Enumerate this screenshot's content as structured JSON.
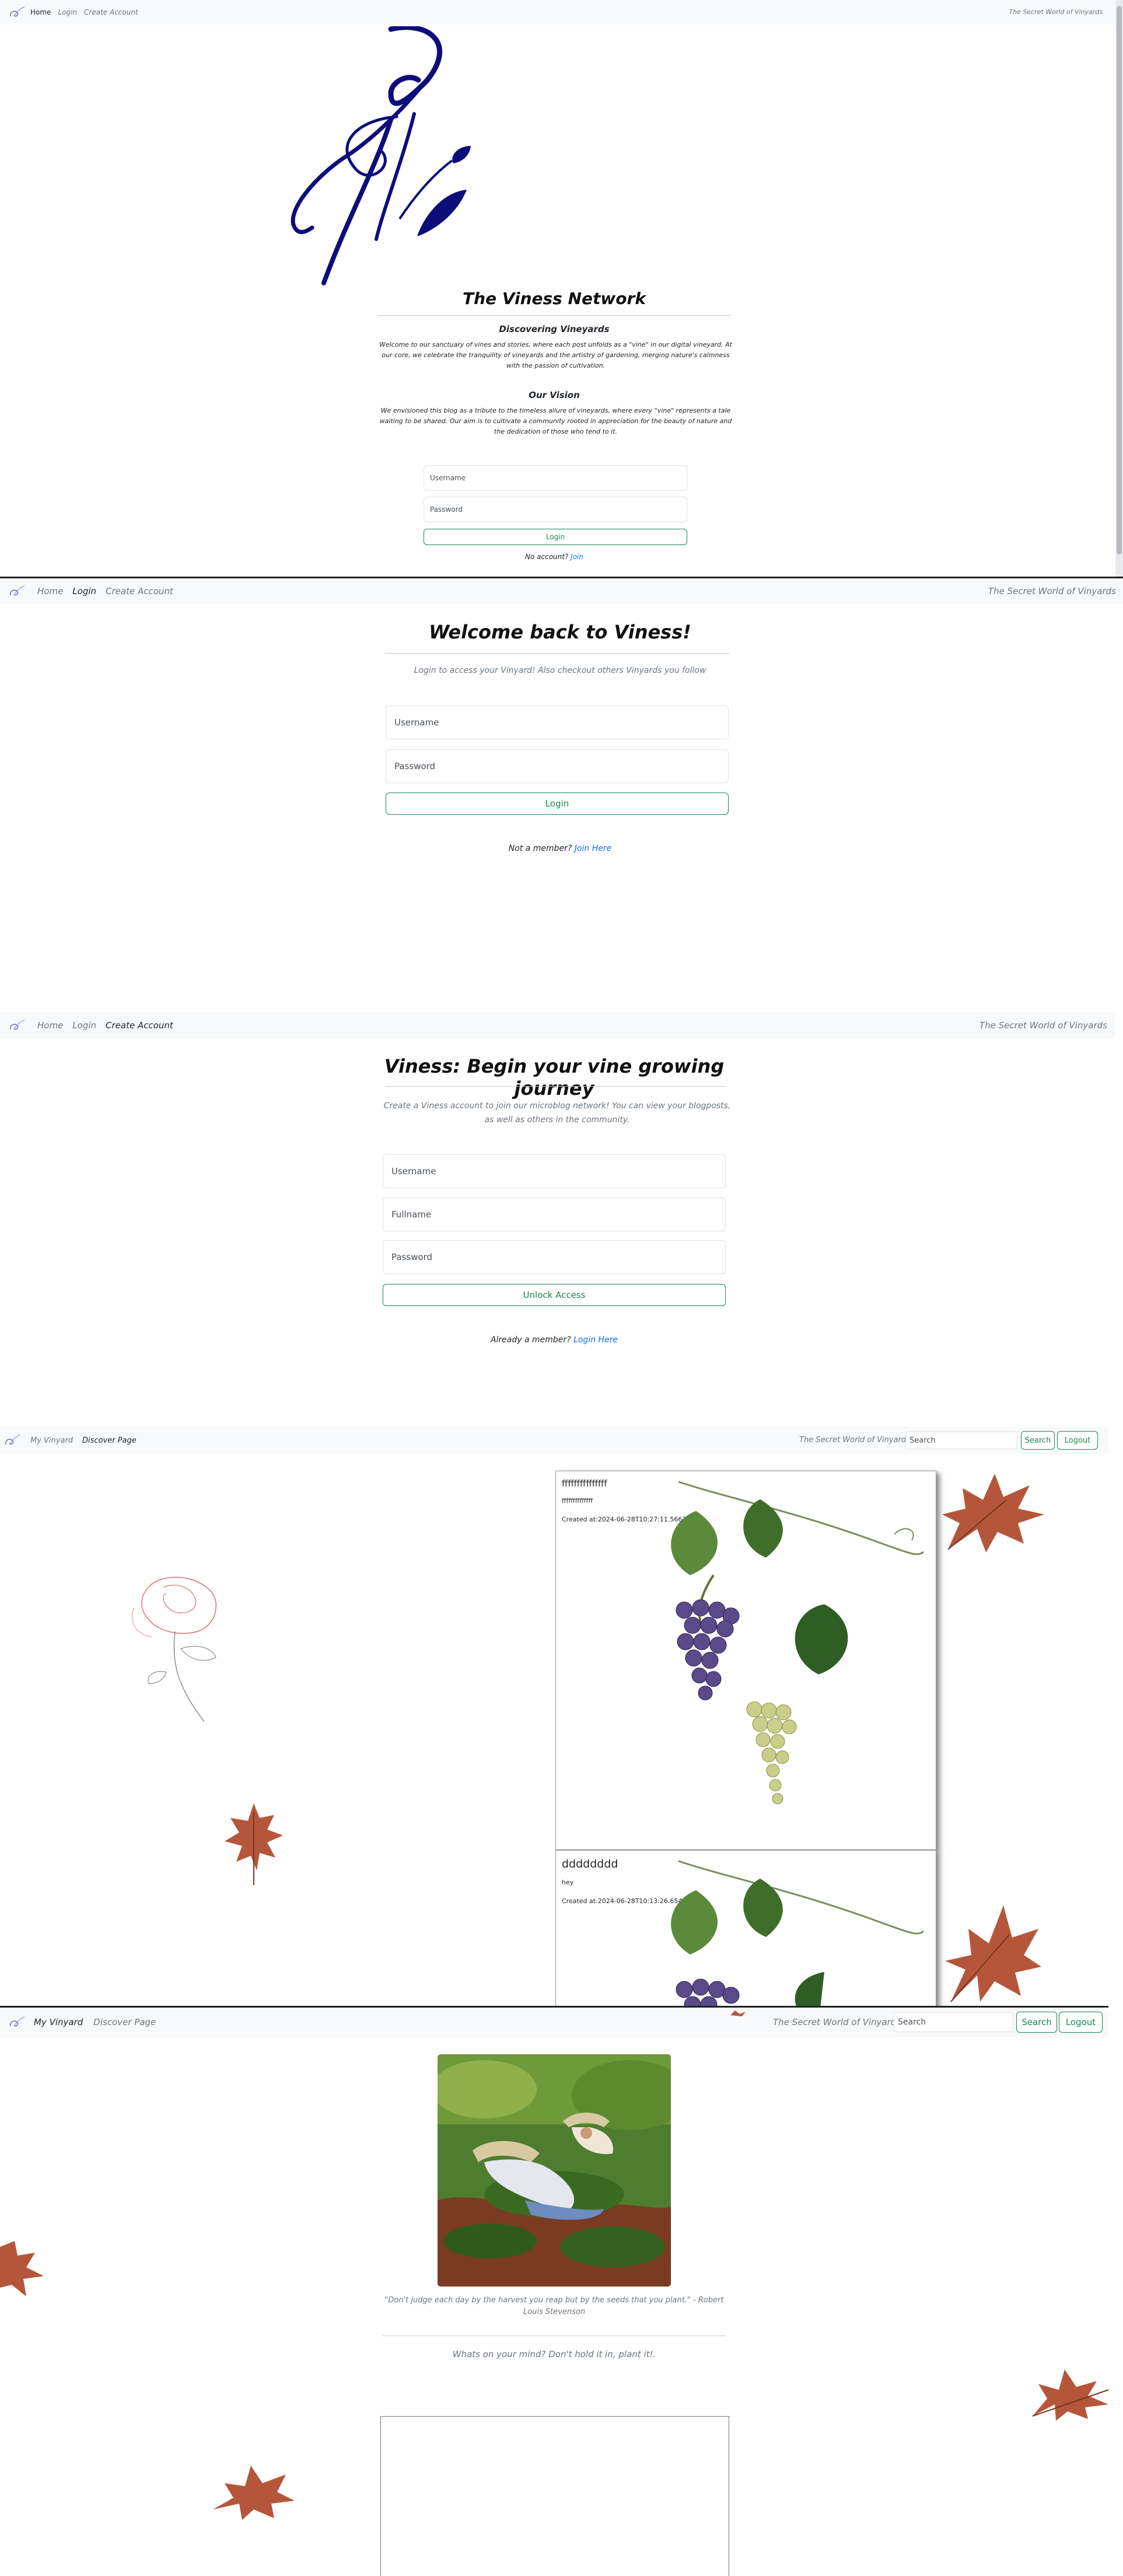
{
  "panel1": {
    "nav": {
      "home": "Home",
      "login": "Login",
      "create": "Create Account",
      "tagline": "The Secret World of Vinyards"
    },
    "title": "The Viness Network",
    "section1_heading": "Discovering Vineyards",
    "section1_text": "Welcome to our sanctuary of vines and stories, where each post unfolds as a \"vine\" in our digital vineyard. At our core, we celebrate the tranquility of vineyards and the artistry of gardening, merging nature's calmness with the passion of cultivation.",
    "section2_heading": "Our Vision",
    "section2_text": "We envisioned this blog as a tribute to the timeless allure of vineyards, where every \"vine\" represents a tale waiting to be shared. Our aim is to cultivate a community rooted in appreciation for the beauty of nature and the dedication of those who tend to it.",
    "username_placeholder": "Username",
    "password_placeholder": "Password",
    "login_button": "Login",
    "no_account": "No account?",
    "join_link": "Join"
  },
  "panel2": {
    "nav": {
      "home": "Home",
      "login": "Login",
      "create": "Create Account",
      "tagline": "The Secret World of Vinyards"
    },
    "title": "Welcome back to Viness!",
    "subtitle": "Login to access your Vinyard! Also checkout others Vinyards you follow",
    "username_placeholder": "Username",
    "password_placeholder": "Password",
    "login_button": "Login",
    "not_member": "Not a member?",
    "join_link": "Join Here"
  },
  "panel3": {
    "nav": {
      "home": "Home",
      "login": "Login",
      "create": "Create Account",
      "tagline": "The Secret World of Vinyards"
    },
    "title": "Viness: Begin your vine growing journey",
    "subtitle": "Create a Viness account to join our microblog network! You can view your blogposts, as well as others in the community.",
    "username_placeholder": "Username",
    "fullname_placeholder": "Fullname",
    "password_placeholder": "Password",
    "submit_button": "Unlock Access",
    "already_member": "Already a member?",
    "login_link": "Login Here"
  },
  "panel4": {
    "nav": {
      "my_vinyard": "My Vinyard",
      "discover": "Discover Page",
      "tagline": "The Secret World of Vinyards",
      "search_placeholder": "Search",
      "search_button": "Search",
      "logout_button": "Logout"
    },
    "posts": [
      {
        "title": "fffffffffffffff",
        "body": "ffffffffffffff",
        "created": "Created at:2024-06-28T10:27:11.566Z"
      },
      {
        "title": "dddddddd",
        "body": "hey",
        "created": "Created at:2024-06-28T10:13:26.654Z"
      }
    ]
  },
  "panel5": {
    "nav": {
      "my_vinyard": "My Vinyard",
      "discover": "Discover Page",
      "tagline": "The Secret World of Vinyards",
      "search_placeholder": "Search",
      "search_button": "Search",
      "logout_button": "Logout"
    },
    "quote": "\"Don't judge each day by the harvest you reap but by the seeds that you plant.\" - Robert Louis Stevenson",
    "prompt": "Whats on your mind? Don't hold it in, plant it!."
  },
  "colors": {
    "accent_green": "#198754",
    "link_blue": "#0d6efd",
    "logo_navy": "#0d0d7a",
    "leaf_rust": "#b5563a"
  }
}
